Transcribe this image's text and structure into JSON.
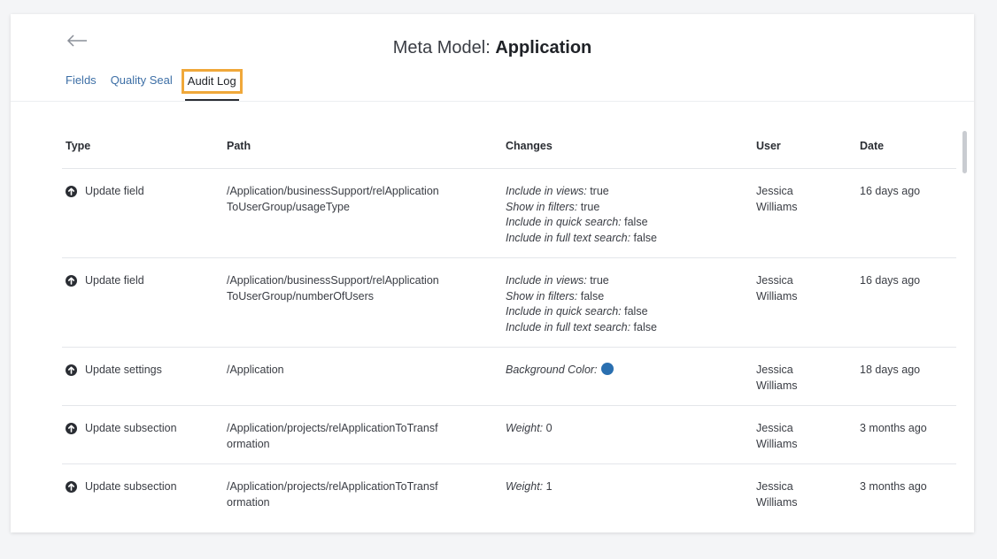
{
  "header": {
    "title_prefix": "Meta Model: ",
    "title_name": "Application",
    "tabs": [
      {
        "label": "Fields"
      },
      {
        "label": "Quality Seal"
      },
      {
        "label": "Audit Log"
      }
    ]
  },
  "table": {
    "columns": [
      "Type",
      "Path",
      "Changes",
      "User",
      "Date"
    ],
    "rows": [
      {
        "type": "Update field",
        "path": "/Application/businessSupport/relApplication\nToUserGroup/usageType",
        "changes": [
          {
            "key": "Include in views:",
            "value": " true"
          },
          {
            "key": "Show in filters:",
            "value": " true"
          },
          {
            "key": "Include in quick search:",
            "value": " false"
          },
          {
            "key": "Include in full text search:",
            "value": " false"
          }
        ],
        "user": "Jessica\nWilliams",
        "date": "16 days ago"
      },
      {
        "type": "Update field",
        "path": "/Application/businessSupport/relApplication\nToUserGroup/numberOfUsers",
        "changes": [
          {
            "key": "Include in views:",
            "value": " true"
          },
          {
            "key": "Show in filters:",
            "value": " false"
          },
          {
            "key": "Include in quick search:",
            "value": " false"
          },
          {
            "key": "Include in full text search:",
            "value": " false"
          }
        ],
        "user": "Jessica\nWilliams",
        "date": "16 days ago"
      },
      {
        "type": "Update settings",
        "path": "/Application",
        "changes": [
          {
            "key": "Background Color:",
            "value": "",
            "color": "#2a6fb0"
          }
        ],
        "user": "Jessica\nWilliams",
        "date": "18 days ago"
      },
      {
        "type": "Update subsection",
        "path": "/Application/projects/relApplicationToTransf\normation",
        "changes": [
          {
            "key": "Weight:",
            "value": " 0"
          }
        ],
        "user": "Jessica\nWilliams",
        "date": "3 months ago"
      },
      {
        "type": "Update subsection",
        "path": "/Application/projects/relApplicationToTransf\normation",
        "changes": [
          {
            "key": "Weight:",
            "value": " 1"
          }
        ],
        "user": "Jessica\nWilliams",
        "date": "3 months ago"
      }
    ]
  },
  "colors": {
    "accent_highlight": "#f0a83a",
    "link": "#3d6fa6"
  },
  "icons": {
    "back": "arrow-left-icon",
    "row_type": "arrow-up-circle-icon"
  }
}
